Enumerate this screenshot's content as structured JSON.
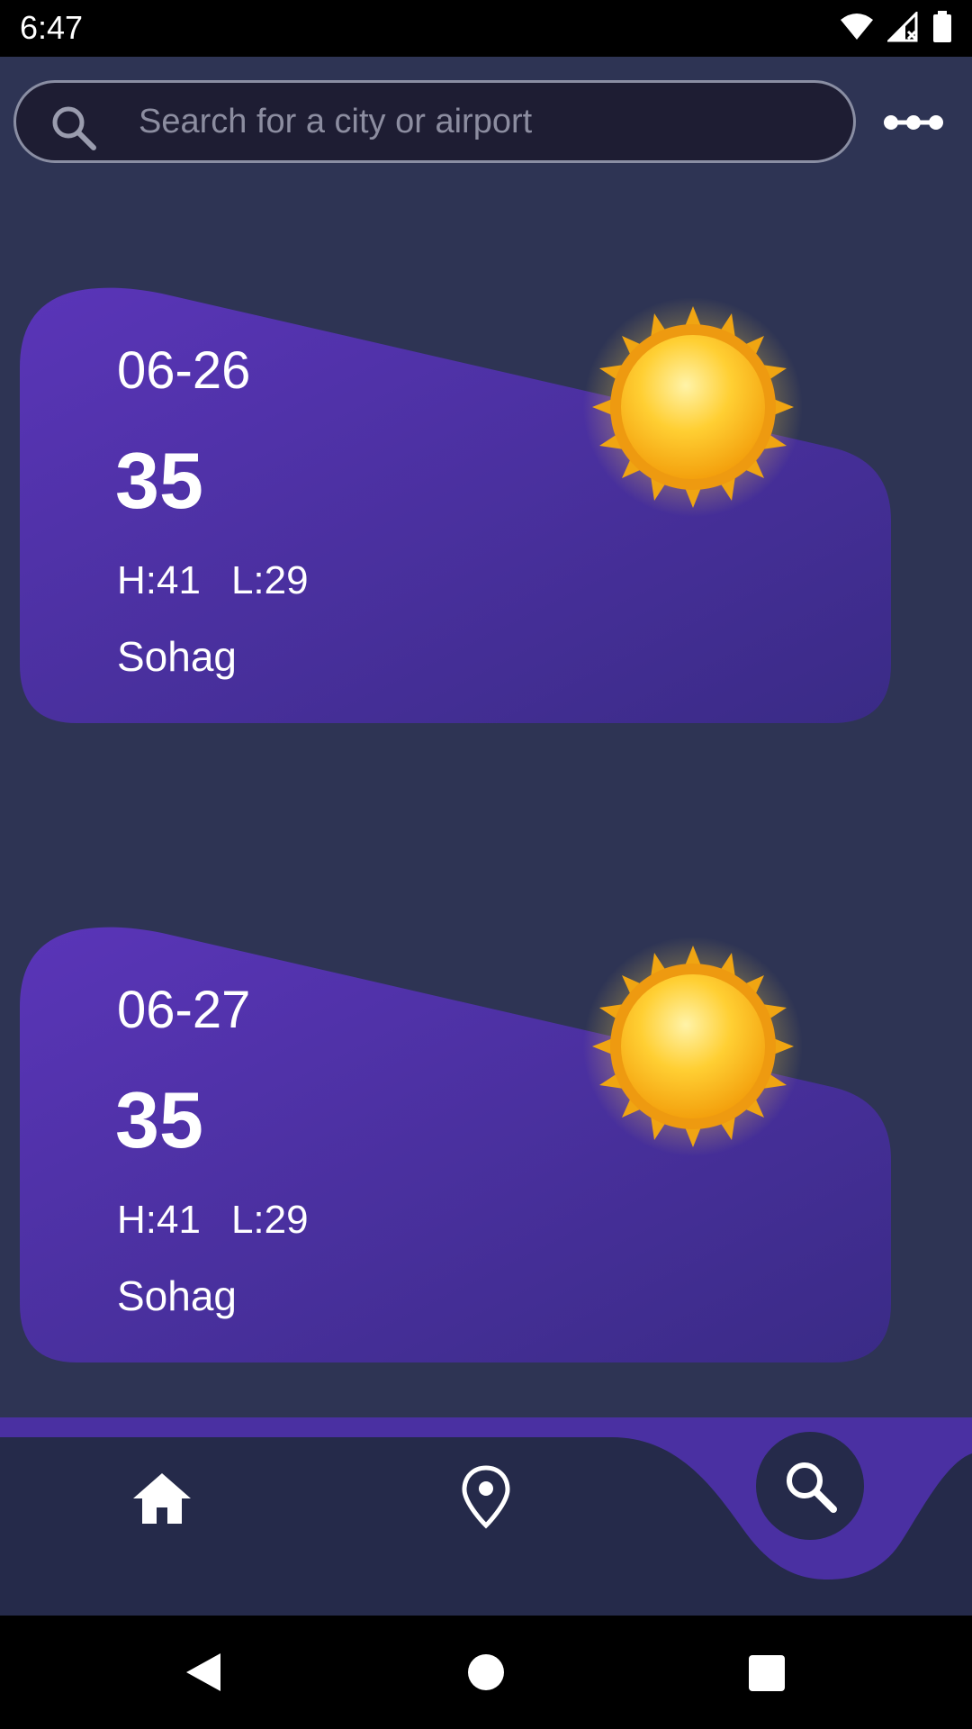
{
  "status_bar": {
    "time": "6:47"
  },
  "search": {
    "placeholder": "Search for a city or airport",
    "value": ""
  },
  "forecast": [
    {
      "date": "06-26",
      "temp": "35",
      "high": "H:41",
      "low": "L:29",
      "city": "Sohag",
      "icon": "sun-icon"
    },
    {
      "date": "06-27",
      "temp": "35",
      "high": "H:41",
      "low": "L:29",
      "city": "Sohag",
      "icon": "sun-icon"
    }
  ],
  "nav": {
    "items": [
      {
        "name": "home",
        "icon": "home-icon"
      },
      {
        "name": "location",
        "icon": "location-pin-icon"
      },
      {
        "name": "search",
        "icon": "search-icon",
        "active": true
      }
    ]
  },
  "colors": {
    "background": "#2e3454",
    "card_start": "#5a35b8",
    "card_end": "#3a2b86",
    "nav_accent": "#4a30a2",
    "nav_bg": "#252a4a"
  }
}
